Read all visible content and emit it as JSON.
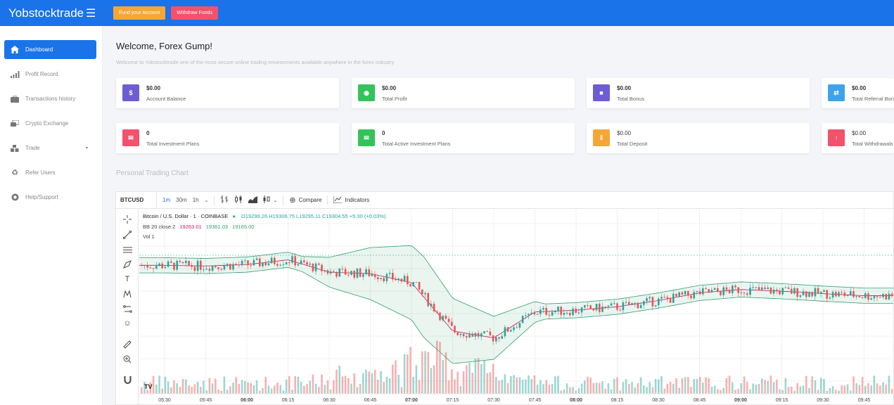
{
  "header": {
    "brand": "Yobstocktrade",
    "menu_icon": "hamburger-icon",
    "fund_button": "Fund your Account",
    "withdraw_button": "Withdraw Funds"
  },
  "sidebar": {
    "items": [
      {
        "label": "Dashboard",
        "icon": "home-icon",
        "active": true
      },
      {
        "label": "Profit Record",
        "icon": "bar-chart-icon"
      },
      {
        "label": "Transactions history",
        "icon": "briefcase-icon"
      },
      {
        "label": "Crypto Exchange",
        "icon": "exchange-icon"
      },
      {
        "label": "Trade",
        "icon": "cubes-icon",
        "caret": "▾"
      },
      {
        "label": "Refer Users",
        "icon": "recycle-icon"
      },
      {
        "label": "Help/Support",
        "icon": "lifebuoy-icon"
      }
    ]
  },
  "welcome": {
    "title": "Welcome, Forex Gump!",
    "subtitle": "Welcome to Yobstocktrade one of the most secure online trading environments available anywhere in the forex industry"
  },
  "cards": [
    {
      "value": "$0.00",
      "label": "Account Balance",
      "icon": "dollar-icon",
      "glyph": "$",
      "color": "#6d5dd3"
    },
    {
      "value": "$0.00",
      "label": "Total Profit",
      "icon": "coins-icon",
      "glyph": "◉",
      "color": "#33c35a"
    },
    {
      "value": "$0.00",
      "label": "Total Bonus",
      "icon": "gift-icon",
      "glyph": "■",
      "color": "#6d5dd3"
    },
    {
      "value": "$0.00",
      "label": "Total Referral Bon",
      "icon": "retweet-icon",
      "glyph": "⇄",
      "color": "#3ea3e8"
    },
    {
      "value": "0",
      "label": "Total Investment Plans",
      "icon": "envelope-icon",
      "glyph": "✉",
      "color": "#f4516c"
    },
    {
      "value": "0",
      "label": "Total Active Investment Plans",
      "icon": "envelope-open-icon",
      "glyph": "✉",
      "color": "#33c35a"
    },
    {
      "value": "$0.00",
      "label": "Total Deposit",
      "icon": "download-icon",
      "glyph": "⇩",
      "color": "#f6a635"
    },
    {
      "value": "$0.00",
      "label": "Total Withdrawals",
      "icon": "arrow-circle-icon",
      "glyph": "↑",
      "color": "#f4516c"
    }
  ],
  "chart_section": {
    "title": "Personal Trading Chart"
  },
  "chart": {
    "symbol": "BTCUSD",
    "timeframes": [
      "1m",
      "30m",
      "1h"
    ],
    "active_timeframe": "1m",
    "compare_label": "Compare",
    "indicators_label": "Indicators",
    "legend_title": "Bitcoin / U.S. Dollar · 1 · COINBASE",
    "ohlc": "O19299.26 H19306.75 L19295.11 C19304.55 +5.30 (+0.03%)",
    "bb_label": "BB 20 close 2",
    "bb_values": [
      "19263.01",
      "19361.03",
      "19165.00"
    ],
    "vol_label": "Vol 1",
    "time_ticks": [
      "05:30",
      "05:45",
      "06:00",
      "06:15",
      "06:30",
      "06:45",
      "07:00",
      "07:15",
      "07:30",
      "07:45",
      "08:00",
      "08:15",
      "08:30",
      "08:45",
      "09:00",
      "09:15",
      "09:30",
      "09:45"
    ],
    "time_ticks_bold": [
      "06:00",
      "07:00",
      "08:00",
      "09:00"
    ],
    "colors": {
      "up": "#26a69a",
      "down": "#ef5350",
      "bb_band": "#2e9e70",
      "bb_basis": "#c2185b"
    }
  },
  "chart_data": {
    "type": "line",
    "title": "Bitcoin / U.S. Dollar · 1 · COINBASE",
    "x": [
      "05:30",
      "05:45",
      "06:00",
      "06:15",
      "06:30",
      "06:45",
      "07:00",
      "07:15",
      "07:30",
      "07:45",
      "08:00",
      "08:15",
      "08:30",
      "08:45",
      "09:00",
      "09:15",
      "09:30",
      "09:45"
    ],
    "series": [
      {
        "name": "BB 20 close 2",
        "values": [
          19320,
          19318,
          19322,
          19336,
          19300,
          19296,
          19270,
          19130,
          19110,
          19185,
          19190,
          19200,
          19218,
          19240,
          19250,
          19245,
          19238,
          19232
        ]
      }
    ],
    "ylim": [
      19050,
      19400
    ],
    "xlabel": "",
    "ylabel": "",
    "grid": true
  }
}
